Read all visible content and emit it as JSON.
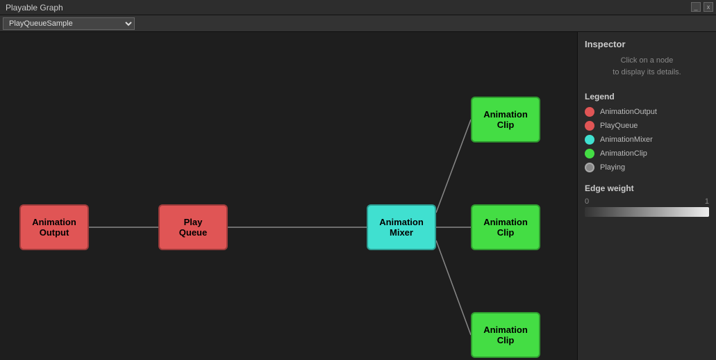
{
  "titleBar": {
    "title": "Playable Graph",
    "minimizeBtn": "_",
    "closeBtn": "x"
  },
  "toolbar": {
    "selectedGraph": "PlayQueueSample",
    "options": [
      "PlayQueueSample"
    ]
  },
  "nodes": {
    "animationOutput": {
      "label": "Animation\nOutput"
    },
    "playQueue": {
      "label": "Play\nQueue"
    },
    "animationMixer": {
      "label": "Animation\nMixer"
    },
    "clipTop": {
      "label": "Animation\nClip"
    },
    "clipMid": {
      "label": "Animation\nClip"
    },
    "clipBot": {
      "label": "Animation\nClip"
    }
  },
  "inspector": {
    "title": "Inspector",
    "hint_line1": "Click on a node",
    "hint_line2": "to display its details."
  },
  "legend": {
    "title": "Legend",
    "items": [
      {
        "label": "AnimationOutput",
        "color": "#e05555"
      },
      {
        "label": "PlayQueue",
        "color": "#e05555"
      },
      {
        "label": "AnimationMixer",
        "color": "#40e0d0"
      },
      {
        "label": "AnimationClip",
        "color": "#44dd44"
      },
      {
        "label": "Playing",
        "color": "#888"
      }
    ]
  },
  "edgeWeight": {
    "title": "Edge weight",
    "min": "0",
    "max": "1"
  }
}
